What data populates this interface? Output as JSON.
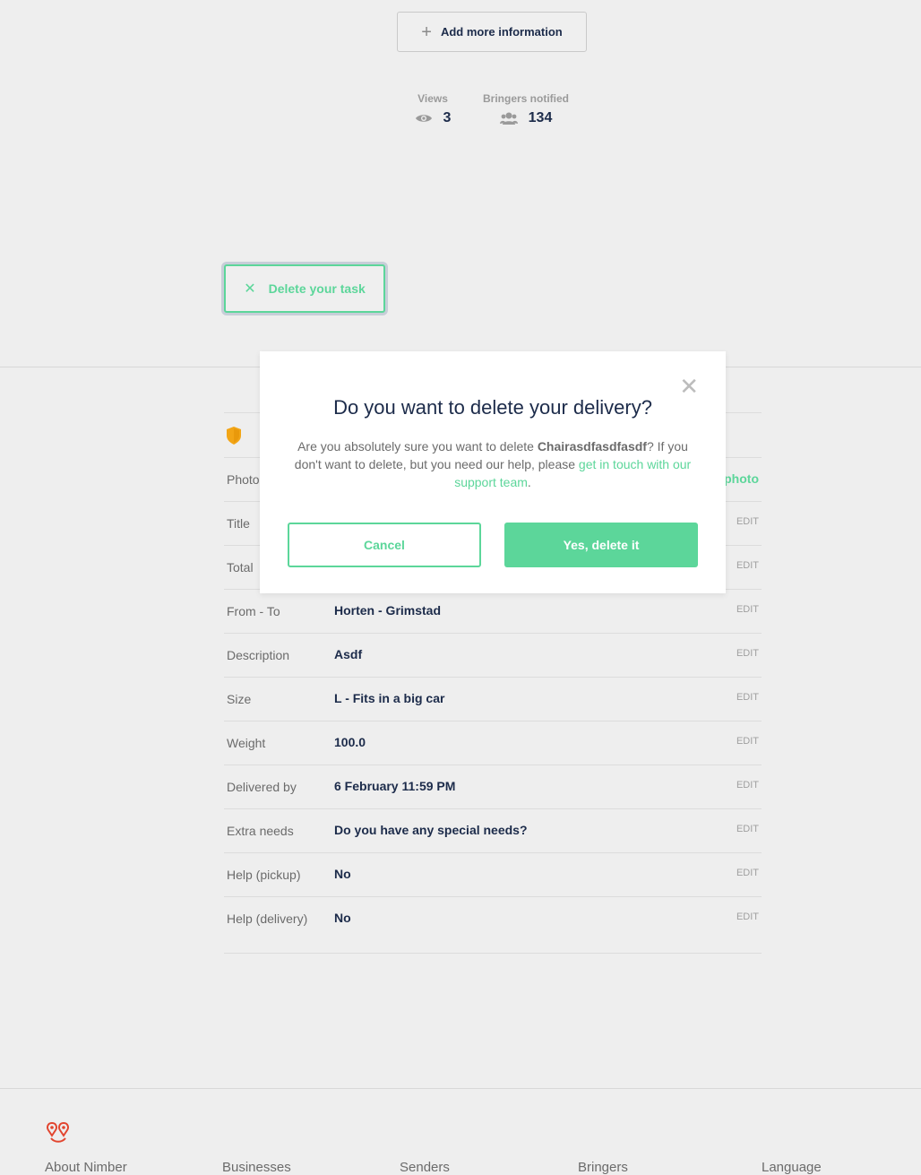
{
  "top": {
    "add_info_label": "Add more information",
    "views_label": "Views",
    "views_value": "3",
    "bringers_label": "Bringers notified",
    "bringers_value": "134",
    "delete_task_label": "Delete your task"
  },
  "details": {
    "photo_key": "Photo",
    "photo_link": "photo",
    "edit_label": "EDIT",
    "rows": [
      {
        "key": "Title",
        "value": ""
      },
      {
        "key": "Total",
        "value": ""
      },
      {
        "key": "From - To",
        "value": "Horten - Grimstad"
      },
      {
        "key": "Description",
        "value": "Asdf"
      },
      {
        "key": "Size",
        "value": "L - Fits in a big car"
      },
      {
        "key": "Weight",
        "value": "100.0"
      },
      {
        "key": "Delivered by",
        "value": "6 February 11:59 PM"
      },
      {
        "key": "Extra needs",
        "value": "Do you have any special needs?"
      },
      {
        "key": "Help (pickup)",
        "value": "No"
      },
      {
        "key": "Help (delivery)",
        "value": "No"
      }
    ]
  },
  "modal": {
    "title": "Do you want to delete your delivery?",
    "body_prefix": "Are you absolutely sure you want to delete ",
    "task_name": "Chairasdfasdfasdf",
    "body_middle": "? If you don't want to delete, but you need our help, please ",
    "support_link": "get in touch with our support team",
    "body_suffix": ".",
    "cancel_label": "Cancel",
    "confirm_label": "Yes, delete it",
    "close_glyph": "✕"
  },
  "footer": {
    "columns": [
      "About Nimber",
      "Businesses",
      "Senders",
      "Bringers",
      "Language"
    ]
  },
  "colors": {
    "accent": "#5cd69a",
    "text_dark": "#1c2b4a",
    "shield": "#f2a516",
    "logo": "#e2452f"
  }
}
